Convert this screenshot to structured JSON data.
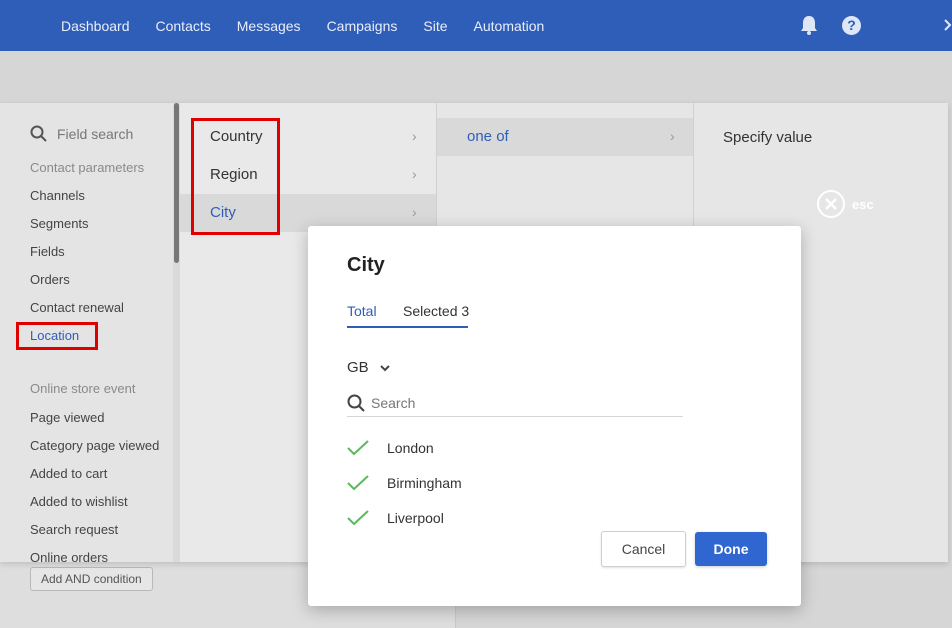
{
  "nav": {
    "items": [
      "Dashboard",
      "Contacts",
      "Messages",
      "Campaigns",
      "Site",
      "Automation"
    ],
    "help_glyph": "?"
  },
  "sidebar": {
    "search_placeholder": "Field search",
    "contact_params_header": "Contact parameters",
    "contact_params": [
      "Channels",
      "Segments",
      "Fields",
      "Orders",
      "Contact renewal",
      "Location"
    ],
    "selected": "Location",
    "store_events_header": "Online store event",
    "store_events": [
      "Page viewed",
      "Category page viewed",
      "Added to cart",
      "Added to wishlist",
      "Search request",
      "Online orders"
    ]
  },
  "location_options": [
    {
      "label": "Country",
      "chevron": "›"
    },
    {
      "label": "Region",
      "chevron": "›"
    },
    {
      "label": "City",
      "chevron": "›"
    }
  ],
  "operator": {
    "label": "one of",
    "chevron": "›"
  },
  "value_panel": {
    "label": "Specify value",
    "esc": "esc"
  },
  "add_condition": "Add AND condition",
  "modal": {
    "title": "City",
    "tab_total": "Total",
    "tab_selected": "Selected 3",
    "country": "GB",
    "search_placeholder": "Search",
    "cities": [
      "London",
      "Birmingham",
      "Liverpool"
    ],
    "cancel": "Cancel",
    "done": "Done"
  },
  "colors": {
    "nav_bg": "#2f5eb8",
    "accent": "#2f5eb8",
    "check": "#5cb85c",
    "highlight_box": "#e00000"
  }
}
